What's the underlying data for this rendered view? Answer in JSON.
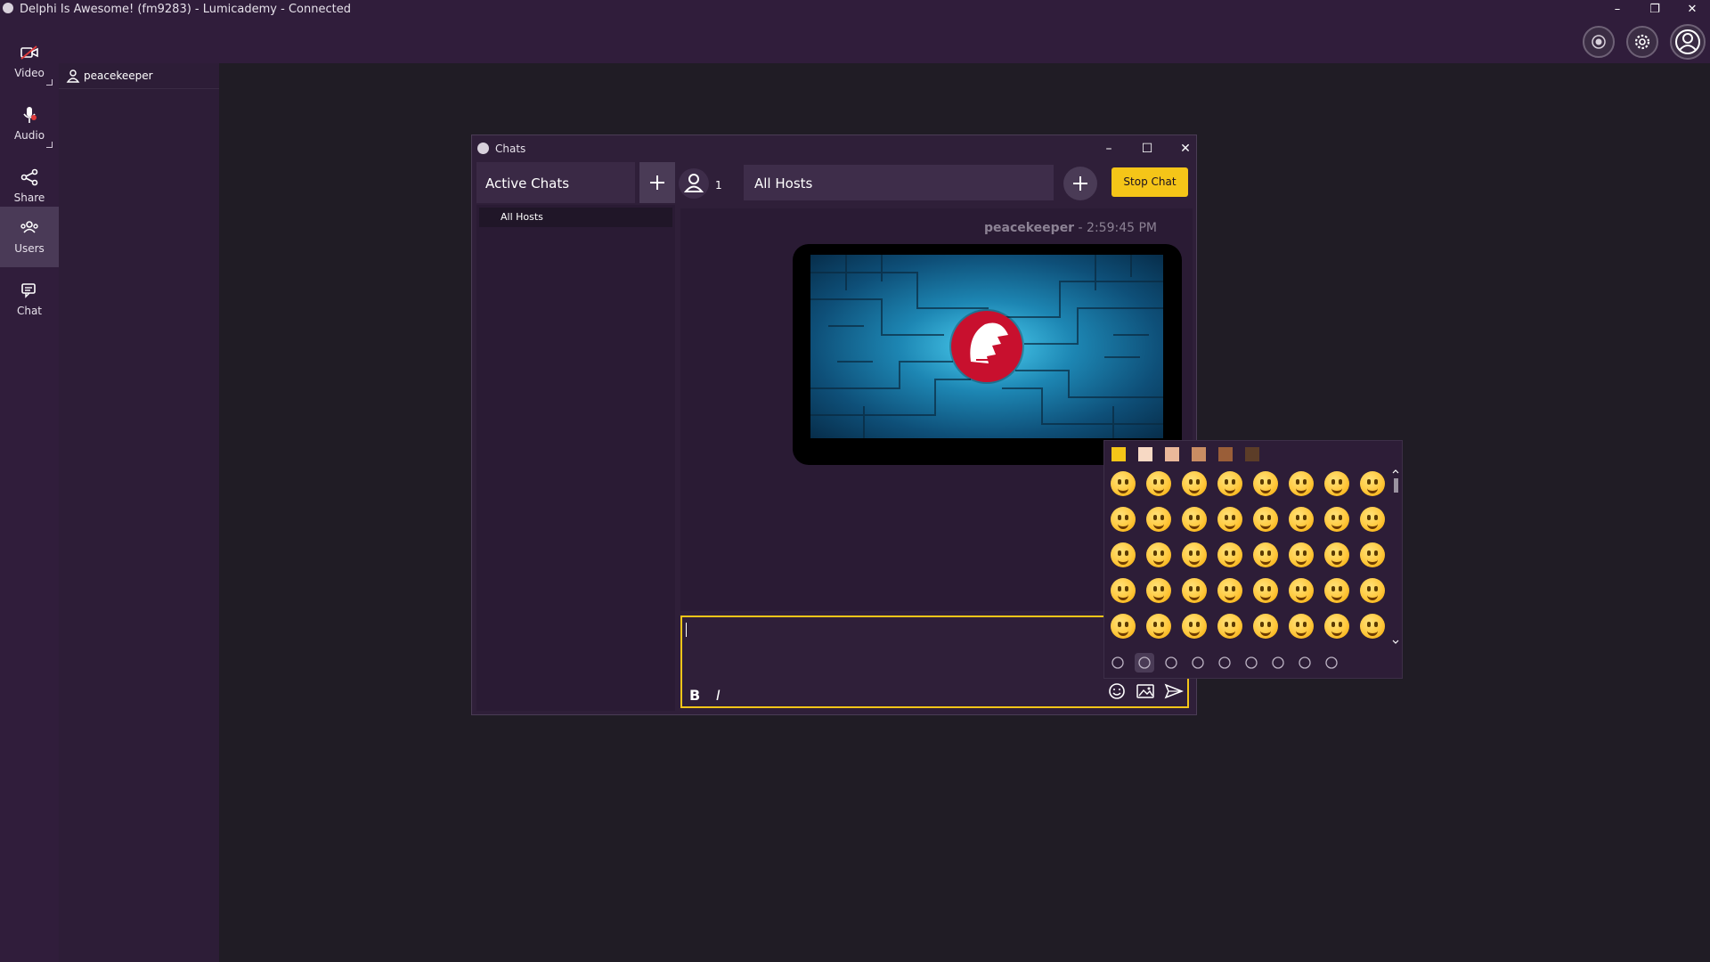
{
  "app": {
    "title": "Delphi Is Awesome! (fm9283) - Lumicademy - Connected",
    "window_buttons": [
      "–",
      "❐",
      "✕"
    ]
  },
  "rail": {
    "items": [
      {
        "label": "Video",
        "icon": "video-camera-icon"
      },
      {
        "label": "Audio",
        "icon": "microphone-icon"
      },
      {
        "label": "Share",
        "icon": "share-icon"
      },
      {
        "label": "Users",
        "icon": "users-icon",
        "active": true
      },
      {
        "label": "Chat",
        "icon": "chat-icon"
      }
    ]
  },
  "top_icons": [
    "record-icon",
    "settings-gear-icon",
    "user-avatar-icon"
  ],
  "users_panel": {
    "users": [
      "peacekeeper"
    ]
  },
  "chats_dialog": {
    "title": "Chats",
    "active_chats_label": "Active Chats",
    "chat_list": [
      "All Hosts"
    ],
    "member_count": "1",
    "room_name": "All Hosts",
    "stop_chat_label": "Stop Chat",
    "message": {
      "sender": "peacekeeper",
      "time": "- 2:59:45 PM",
      "image_description_icon": "delphi-logo-icon"
    },
    "composer": {
      "bold": "B",
      "italic": "I"
    }
  },
  "emoji_picker": {
    "skin_tones": [
      "#f5c518",
      "#f7d9c4",
      "#eab89a",
      "#c98d63",
      "#9a5e38",
      "#5c3d28"
    ],
    "categories": [
      "recent-icon",
      "smileys-icon",
      "nature-icon",
      "food-icon",
      "places-icon",
      "activities-icon",
      "objects-icon",
      "symbols-icon",
      "flags-icon"
    ],
    "selected_category": "smileys-icon"
  },
  "colors": {
    "accent": "#f5c518",
    "background": "#201c25",
    "panel": "#301d3b"
  }
}
